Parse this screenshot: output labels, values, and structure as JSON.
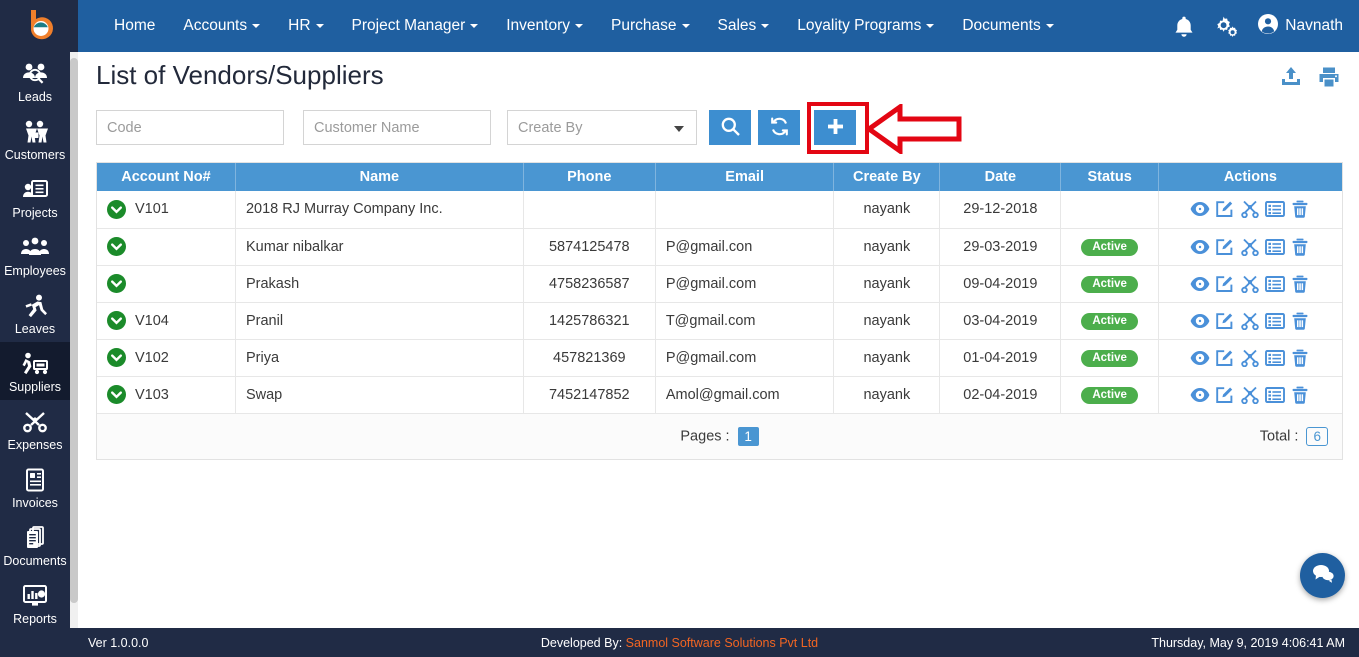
{
  "brand": {
    "logo_alt": "brand-logo"
  },
  "topnav": {
    "items": [
      {
        "label": "Home",
        "has_caret": false
      },
      {
        "label": "Accounts",
        "has_caret": true
      },
      {
        "label": "HR",
        "has_caret": true
      },
      {
        "label": "Project Manager",
        "has_caret": true
      },
      {
        "label": "Inventory",
        "has_caret": true
      },
      {
        "label": "Purchase",
        "has_caret": true
      },
      {
        "label": "Sales",
        "has_caret": true
      },
      {
        "label": "Loyality Programs",
        "has_caret": true
      },
      {
        "label": "Documents",
        "has_caret": true
      }
    ],
    "notification_icon": "bell-icon",
    "settings_icon": "gears-icon",
    "user_name": "Navnath",
    "user_icon": "user-circle-icon"
  },
  "sidebar": {
    "items": [
      {
        "label": "Leads",
        "icon": "leads-icon",
        "active": false
      },
      {
        "label": "Customers",
        "icon": "customers-icon",
        "active": false
      },
      {
        "label": "Projects",
        "icon": "projects-icon",
        "active": false
      },
      {
        "label": "Employees",
        "icon": "employees-icon",
        "active": false
      },
      {
        "label": "Leaves",
        "icon": "leaves-icon",
        "active": false
      },
      {
        "label": "Suppliers",
        "icon": "suppliers-icon",
        "active": true
      },
      {
        "label": "Expenses",
        "icon": "expenses-icon",
        "active": false
      },
      {
        "label": "Invoices",
        "icon": "invoices-icon",
        "active": false
      },
      {
        "label": "Documents",
        "icon": "documents-icon",
        "active": false
      },
      {
        "label": "Reports",
        "icon": "reports-icon",
        "active": false
      }
    ]
  },
  "page": {
    "title": "List of Vendors/Suppliers",
    "upload_icon": "upload-icon",
    "print_icon": "print-icon"
  },
  "filters": {
    "code_placeholder": "Code",
    "code_value": "",
    "name_placeholder": "Customer Name",
    "name_value": "",
    "createby_label": "Create By",
    "search_icon": "search-icon",
    "refresh_icon": "refresh-icon",
    "add_icon": "plus-icon"
  },
  "annotation": {
    "highlight_target": "add-new-vendor-button",
    "arrow_direction": "left",
    "color": "#e30613"
  },
  "table": {
    "columns": [
      "Account No#",
      "Name",
      "Phone",
      "Email",
      "Create By",
      "Date",
      "Status",
      "Actions"
    ],
    "action_icons": [
      "eye-icon",
      "edit-icon",
      "scissors-icon",
      "list-icon",
      "trash-icon"
    ],
    "rows": [
      {
        "account_no": "V101",
        "name": "2018 RJ Murray Company Inc.",
        "phone": "",
        "email": "",
        "create_by": "nayank",
        "date": "29-12-2018",
        "status": ""
      },
      {
        "account_no": "",
        "name": "Kumar nibalkar",
        "phone": "5874125478",
        "email": "P@gmail.con",
        "create_by": "nayank",
        "date": "29-03-2019",
        "status": "Active"
      },
      {
        "account_no": "",
        "name": "Prakash",
        "phone": "4758236587",
        "email": "P@gmail.com",
        "create_by": "nayank",
        "date": "09-04-2019",
        "status": "Active"
      },
      {
        "account_no": "V104",
        "name": "Pranil",
        "phone": "1425786321",
        "email": "T@gmail.com",
        "create_by": "nayank",
        "date": "03-04-2019",
        "status": "Active"
      },
      {
        "account_no": "V102",
        "name": "Priya",
        "phone": "457821369",
        "email": "P@gmail.com",
        "create_by": "nayank",
        "date": "01-04-2019",
        "status": "Active"
      },
      {
        "account_no": "V103",
        "name": "Swap",
        "phone": "7452147852",
        "email": "Amol@gmail.com",
        "create_by": "nayank",
        "date": "02-04-2019",
        "status": "Active"
      }
    ],
    "pages_label": "Pages :",
    "current_page": "1",
    "total_label": "Total :",
    "total_count": "6"
  },
  "chat": {
    "icon": "chat-icon"
  },
  "footer": {
    "version": "Ver 1.0.0.0",
    "developed_prefix": "Developed By:",
    "developed_by": "Sanmol Software Solutions Pvt Ltd",
    "datetime": "Thursday, May 9, 2019 4:06:41 AM"
  },
  "colors": {
    "navy": "#202b45",
    "nav_blue": "#1f5fa0",
    "accent_blue": "#4a96d2",
    "button_blue": "#3d8ed0",
    "green": "#4cae4c",
    "orange": "#f26522",
    "annotation_red": "#e30613"
  }
}
